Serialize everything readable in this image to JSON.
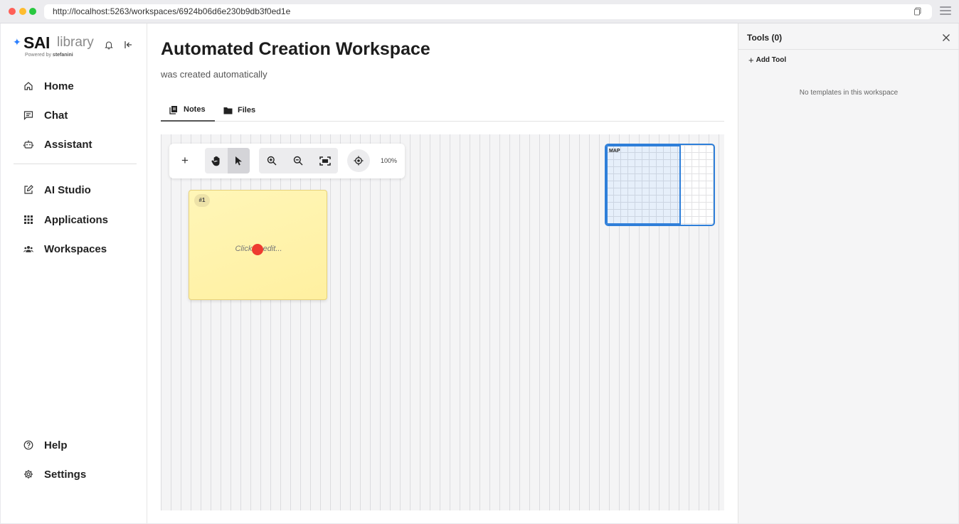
{
  "browser": {
    "url": "http://localhost:5263/workspaces/6924b06d6e230b9db3f0ed1e"
  },
  "logo": {
    "brand": "SAI",
    "product": "library",
    "powered_by": "Powered by",
    "company": "stefanini"
  },
  "sidebar": {
    "items": [
      {
        "label": "Home",
        "icon": "home-icon"
      },
      {
        "label": "Chat",
        "icon": "chat-icon"
      },
      {
        "label": "Assistant",
        "icon": "robot-icon"
      },
      {
        "label": "AI Studio",
        "icon": "edit-icon"
      },
      {
        "label": "Applications",
        "icon": "grid-icon"
      },
      {
        "label": "Workspaces",
        "icon": "people-icon"
      }
    ],
    "footer": [
      {
        "label": "Help",
        "icon": "help-icon"
      },
      {
        "label": "Settings",
        "icon": "gear-icon"
      }
    ]
  },
  "workspace": {
    "title": "Automated Creation Workspace",
    "description": "was created automatically",
    "tabs": [
      {
        "label": "Notes",
        "active": true
      },
      {
        "label": "Files",
        "active": false
      }
    ]
  },
  "canvas": {
    "toolbar": {
      "add_label": "+",
      "zoom_level": "100%",
      "active_tool": "pointer"
    },
    "notes": [
      {
        "badge": "#1",
        "placeholder": "Click to edit..."
      }
    ],
    "minimap": {
      "label": "MAP"
    }
  },
  "tools_panel": {
    "title": "Tools (0)",
    "add_label": "Add Tool",
    "empty_message": "No templates in this workspace"
  },
  "colors": {
    "accent": "#2f7fd9",
    "sticky": "#fff2a8",
    "cursor": "#ee3b30"
  }
}
